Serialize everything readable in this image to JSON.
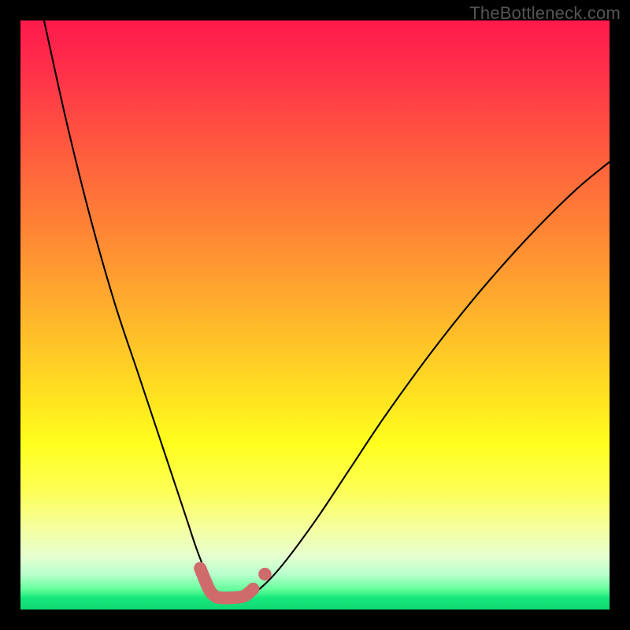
{
  "attribution": "TheBottleneck.com",
  "colors": {
    "frame": "#000000",
    "curve": "#000000",
    "marker": "#cf6b6b",
    "attribution_text": "#555555"
  },
  "chart_data": {
    "type": "line",
    "title": "",
    "xlabel": "",
    "ylabel": "",
    "xlim": [
      0,
      100
    ],
    "ylim": [
      0,
      100
    ],
    "grid": false,
    "legend": false,
    "series": [
      {
        "name": "bottleneck-curve",
        "x": [
          4,
          8,
          12,
          16,
          20,
          24,
          28,
          30,
          32,
          33,
          34,
          36,
          38,
          40,
          44,
          50,
          56,
          62,
          70,
          78,
          86,
          94,
          100
        ],
        "y": [
          100,
          82,
          66,
          52,
          40,
          28,
          16,
          10,
          5,
          3,
          2,
          2,
          2,
          3,
          7,
          15,
          24,
          33,
          44,
          54,
          63,
          71,
          76
        ]
      }
    ],
    "highlight": {
      "name": "bottom-marker",
      "x": [
        30.5,
        32,
        33,
        34,
        36,
        38,
        39.5
      ],
      "y": [
        7,
        3.5,
        2.3,
        2,
        2,
        2.3,
        3.5
      ]
    },
    "highlight_dot": {
      "x": 41.5,
      "y": 6
    }
  }
}
